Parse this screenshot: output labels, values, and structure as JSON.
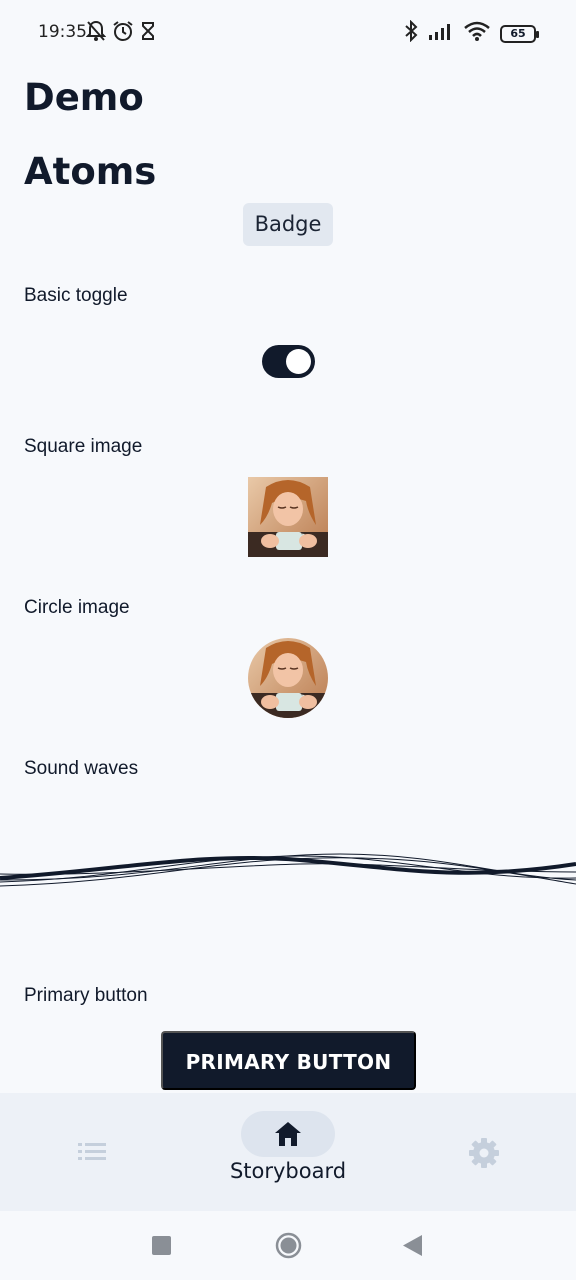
{
  "status_bar": {
    "time": "19:35",
    "icons_left": [
      "bell-muted-icon",
      "alarm-icon",
      "hourglass-icon"
    ],
    "icons_right": [
      "bluetooth-icon",
      "signal-icon",
      "wifi-icon",
      "battery-icon"
    ],
    "battery_level": "65"
  },
  "page": {
    "title": "Demo",
    "section_title": "Atoms"
  },
  "badge": {
    "label": "Badge"
  },
  "toggle": {
    "label": "Basic toggle",
    "checked": true
  },
  "square_image": {
    "label": "Square image"
  },
  "circle_image": {
    "label": "Circle image"
  },
  "sound_waves": {
    "label": "Sound waves"
  },
  "primary_button": {
    "label": "Primary button",
    "button_text": "PRIMARY BUTTON"
  },
  "bottom_nav": {
    "items": [
      {
        "icon": "list-icon",
        "label": "",
        "active": false
      },
      {
        "icon": "home-icon",
        "label": "Storyboard",
        "active": true
      },
      {
        "icon": "gear-icon",
        "label": "",
        "active": false
      }
    ]
  },
  "system_nav": {
    "buttons": [
      "recents",
      "home",
      "back"
    ]
  },
  "colors": {
    "primary": "#111a2b",
    "background": "#f7f9fc",
    "badge_bg": "#e2e8f0",
    "nav_bg": "#edf1f7",
    "inactive_icon": "#c5cfdc"
  }
}
